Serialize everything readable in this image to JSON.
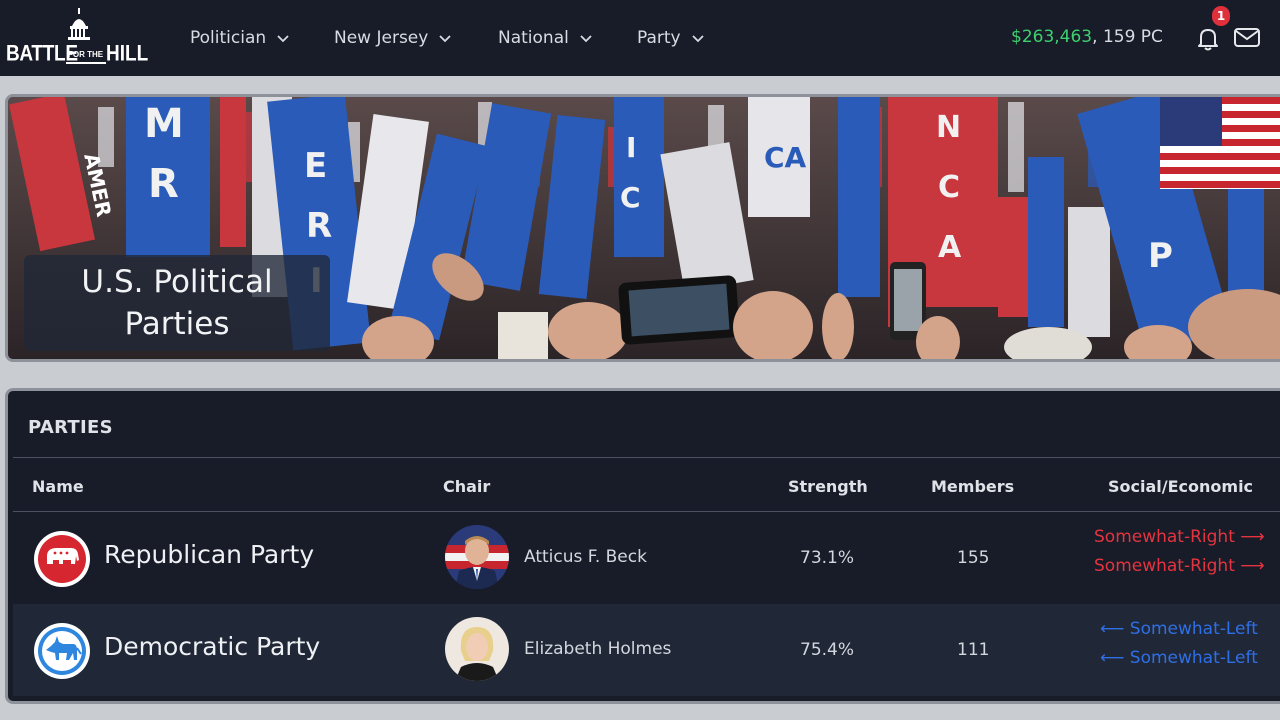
{
  "navbar": {
    "logo": {
      "line1": "BATTLE",
      "line2": "FOR THE",
      "line3": "HILL"
    },
    "menu": [
      {
        "label": "Politician"
      },
      {
        "label": "New Jersey"
      },
      {
        "label": "National"
      },
      {
        "label": "Party"
      }
    ],
    "funds": {
      "cash": "$263,463",
      "separator": ",",
      "pc": "159 PC"
    },
    "notifications": {
      "count": "1",
      "icon": "bell-icon"
    },
    "messages": {
      "icon": "mail-icon"
    },
    "colors": {
      "background": "#171c28",
      "cash": "#3ecf6e",
      "badge": "#e0303b"
    }
  },
  "hero": {
    "title": "U.S. Political Parties",
    "image": "convention-crowd-with-america-signs",
    "flag_icon": "us-flag-icon"
  },
  "parties": {
    "header": "PARTIES",
    "columns": [
      "Name",
      "Chair",
      "Strength",
      "Members",
      "Social/Economic"
    ],
    "rows": [
      {
        "name": "Republican Party",
        "logo_icon": "elephant-icon",
        "chair": "Atticus F. Beck",
        "strength": "73.1%",
        "members": "155",
        "social": "Somewhat-Right",
        "economic": "Somewhat-Right",
        "lean_arrow": "⟶",
        "color": "#e5343f"
      },
      {
        "name": "Democratic Party",
        "logo_icon": "donkey-icon",
        "chair": "Elizabeth Holmes",
        "strength": "75.4%",
        "members": "111",
        "social": "Somewhat-Left",
        "economic": "Somewhat-Left",
        "lean_arrow": "⟵",
        "color": "#2f6fe6"
      }
    ]
  }
}
